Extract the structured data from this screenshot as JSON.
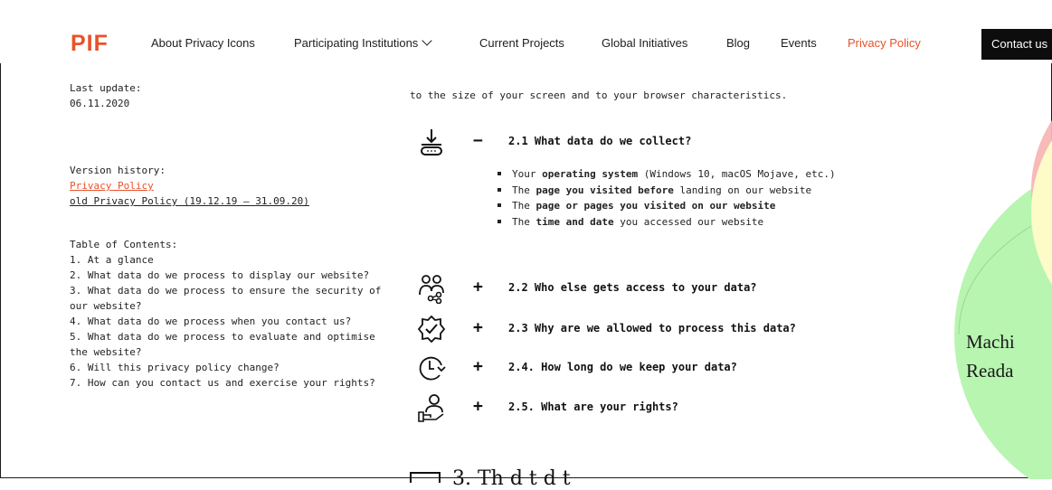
{
  "header": {
    "logo": "PIF",
    "nav": [
      {
        "label": "About Privacy Icons"
      },
      {
        "label": "Participating Institutions"
      },
      {
        "label": "Current Projects"
      },
      {
        "label": "Global Initiatives"
      },
      {
        "label": "Blog"
      },
      {
        "label": "Events"
      },
      {
        "label": "Privacy Policy"
      }
    ],
    "contact_button": "Contact us"
  },
  "sidebar": {
    "last_update_label": "Last update:",
    "last_update_value": "06.11.2020",
    "version_history_label": "Version history:",
    "version_links": [
      "Privacy Policy",
      "old Privacy Policy (19.12.19 – 31.09.20)"
    ],
    "toc_label": "Table of Contents:",
    "toc_items": [
      "1. At a glance",
      "2. What data do we process to display our website?",
      "3. What data do we process to ensure the security of our website?",
      "4. What data do we process when you contact us?",
      "5. What data do we process to evaluate and optimise the website?",
      "6. Will this privacy policy change?",
      "7. How can you contact us and exercise your rights?"
    ]
  },
  "main": {
    "intro_line": "to the size of your screen and to your browser characteristics.",
    "sections": [
      {
        "toggle": "−",
        "title": "2.1 What data do we collect?",
        "icon": "download-device-icon"
      },
      {
        "toggle": "+",
        "title": "2.2 Who else gets access to your data?",
        "icon": "people-share-icon"
      },
      {
        "toggle": "+",
        "title": "2.3 Why are we allowed to process this data?",
        "icon": "verified-badge-icon"
      },
      {
        "toggle": "+",
        "title": "2.4. How long do we keep your data?",
        "icon": "clock-icon"
      },
      {
        "toggle": "+",
        "title": "2.5. What are your rights?",
        "icon": "person-hand-icon"
      }
    ],
    "bullets": [
      {
        "pre": "Your ",
        "bold": "operating system",
        "post": " (Windows 10, macOS Mojave, etc.)"
      },
      {
        "pre": "The ",
        "bold": "page you visited before",
        "post": " landing on our website"
      },
      {
        "pre": "The ",
        "bold": "page or pages you visited on our website",
        "post": ""
      },
      {
        "pre": "The ",
        "bold": "time and date",
        "post": " you accessed our website"
      }
    ],
    "bottom_text": "3. Th  d t d       t"
  },
  "venn": {
    "lines": [
      "Machi",
      "Reada"
    ],
    "colors": {
      "green": "#b7f5b0",
      "yellow": "#fdfcc9",
      "pink": "#f7b6b4"
    }
  },
  "colors": {
    "accent": "#e8522a",
    "button_bg": "#0d0d0d"
  }
}
